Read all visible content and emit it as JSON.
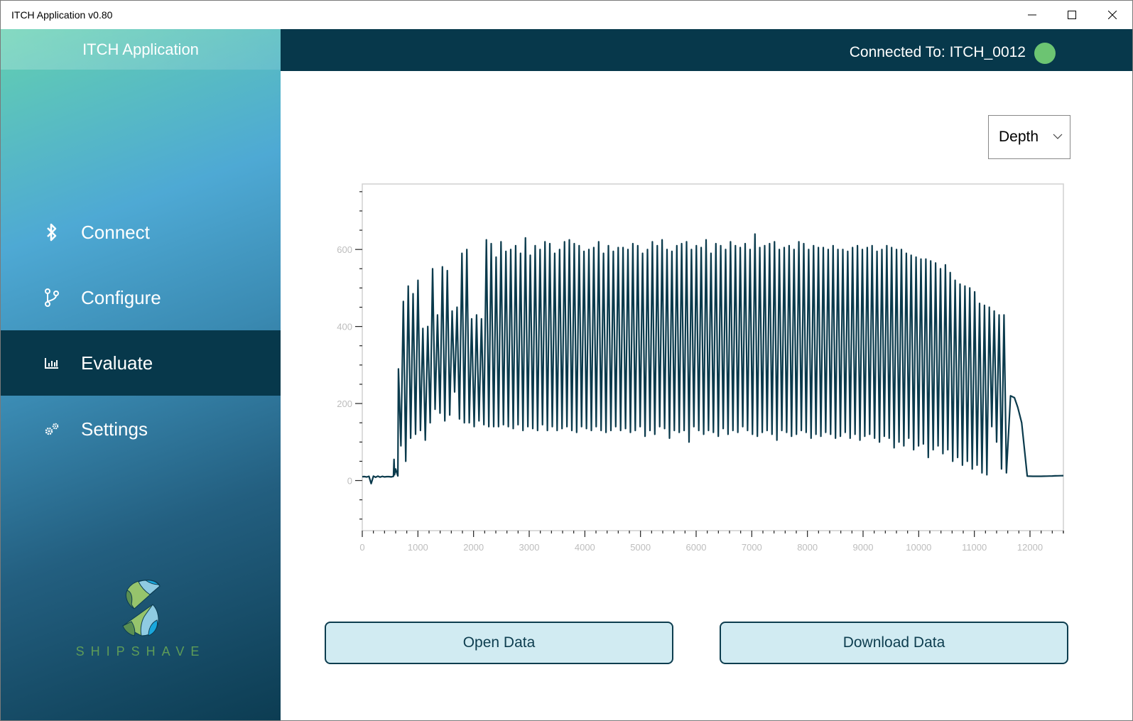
{
  "window": {
    "title": "ITCH Application v0.80"
  },
  "sidebar": {
    "brand": "ITCH Application",
    "items": [
      {
        "label": "Connect",
        "icon": "bluetooth-icon",
        "active": false
      },
      {
        "label": "Configure",
        "icon": "branch-icon",
        "active": false
      },
      {
        "label": "Evaluate",
        "icon": "bar-chart-icon",
        "active": true
      },
      {
        "label": "Settings",
        "icon": "gears-icon",
        "active": false
      }
    ],
    "logo_text": "SHIPSHAVE"
  },
  "header": {
    "connection_text": "Connected To: ITCH_0012",
    "status": "connected",
    "status_color": "#6cc472"
  },
  "main": {
    "metric_dropdown": {
      "selected": "Depth"
    },
    "buttons": {
      "open_label": "Open Data",
      "download_label": "Download Data"
    }
  },
  "colors": {
    "accent_dark": "#07384b",
    "line": "#0a3a4c",
    "button_bg": "#d1ebf2"
  },
  "chart_data": {
    "type": "line",
    "title": "",
    "xlabel": "",
    "ylabel": "",
    "xlim": [
      0,
      12600
    ],
    "ylim": [
      -130,
      770
    ],
    "x_ticks": [
      0,
      1000,
      2000,
      3000,
      4000,
      5000,
      6000,
      7000,
      8000,
      9000,
      10000,
      11000,
      12000
    ],
    "y_ticks": [
      0,
      200,
      400,
      600
    ],
    "grid": false,
    "legend": "none",
    "series": [
      {
        "name": "Depth",
        "baseline_start": {
          "x": [
            0,
            560
          ],
          "y": 10
        },
        "baseline_end": {
          "x": [
            11950,
            12600
          ],
          "y": 12
        },
        "oscillation": {
          "x_start": 650,
          "x_end": 11620,
          "peaks": [
            290,
            465,
            505,
            485,
            520,
            395,
            400,
            550,
            430,
            555,
            545,
            440,
            450,
            590,
            600,
            420,
            430,
            420,
            625,
            615,
            580,
            620,
            595,
            600,
            610,
            590,
            630,
            585,
            610,
            600,
            620,
            615,
            590,
            600,
            620,
            625,
            615,
            610,
            595,
            600,
            605,
            620,
            590,
            610,
            595,
            605,
            605,
            600,
            615,
            610,
            590,
            600,
            620,
            610,
            625,
            600,
            595,
            610,
            615,
            620,
            600,
            610,
            605,
            625,
            590,
            615,
            610,
            600,
            620,
            610,
            605,
            615,
            600,
            640,
            605,
            610,
            615,
            620,
            600,
            605,
            610,
            600,
            620,
            615,
            600,
            610,
            605,
            605,
            600,
            610,
            600,
            600,
            595,
            605,
            610,
            600,
            605,
            610,
            595,
            600,
            610,
            605,
            600,
            600,
            590,
            585,
            580,
            575,
            575,
            570,
            565,
            550,
            560,
            540,
            520,
            510,
            505,
            500,
            490,
            460,
            455,
            450,
            440,
            430,
            430
          ],
          "troughs": [
            90,
            50,
            110,
            120,
            130,
            105,
            150,
            185,
            175,
            155,
            170,
            230,
            160,
            150,
            150,
            140,
            155,
            145,
            140,
            140,
            140,
            145,
            140,
            135,
            145,
            130,
            140,
            135,
            130,
            145,
            130,
            140,
            130,
            135,
            140,
            130,
            125,
            140,
            135,
            130,
            140,
            130,
            125,
            130,
            140,
            130,
            135,
            125,
            130,
            140,
            115,
            130,
            120,
            140,
            135,
            110,
            130,
            125,
            130,
            100,
            140,
            130,
            120,
            130,
            125,
            115,
            135,
            120,
            130,
            125,
            140,
            130,
            120,
            115,
            125,
            130,
            120,
            105,
            130,
            125,
            115,
            120,
            130,
            125,
            110,
            120,
            115,
            125,
            120,
            110,
            115,
            125,
            110,
            120,
            105,
            115,
            120,
            110,
            100,
            115,
            110,
            85,
            100,
            90,
            110,
            80,
            90,
            95,
            60,
            80,
            90,
            70,
            80,
            50,
            60,
            40,
            50,
            30,
            40,
            20,
            15,
            140,
            100,
            30,
            20
          ]
        },
        "tail": {
          "x": [
            11650,
            11720,
            11780,
            11850,
            11950
          ],
          "y": [
            220,
            215,
            190,
            150,
            12
          ]
        }
      }
    ]
  }
}
